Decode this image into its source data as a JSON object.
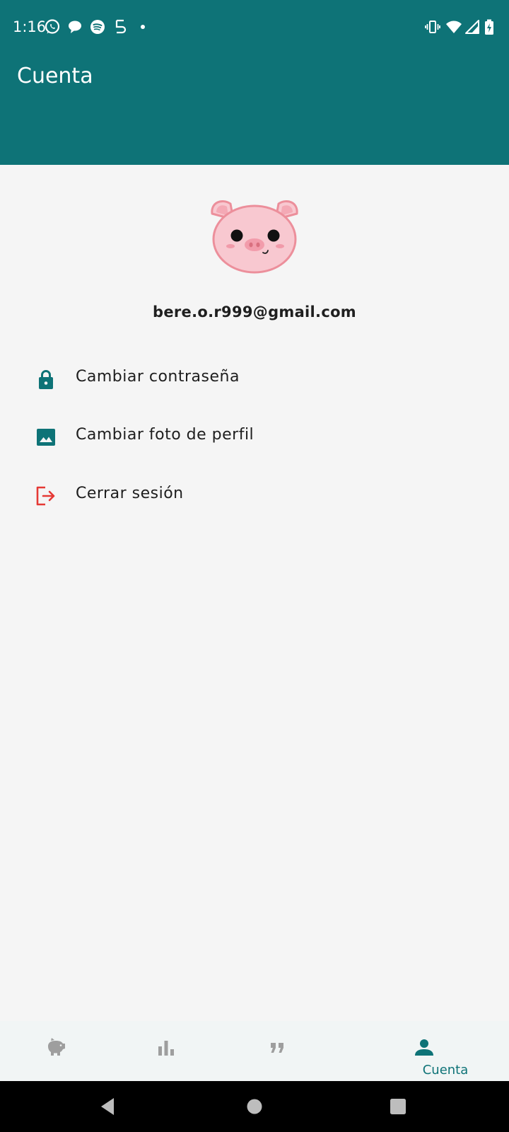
{
  "status_bar": {
    "time": "1:16",
    "notification_icons": [
      "whatsapp-icon",
      "chat-bubble-icon",
      "spotify-icon",
      "s-app-icon",
      "dot-icon"
    ],
    "system_icons": [
      "vibrate-icon",
      "wifi-icon",
      "signal-icon",
      "battery-charging-icon"
    ]
  },
  "app_bar": {
    "title": "Cuenta"
  },
  "profile": {
    "avatar_icon": "pig-face-icon",
    "email": "bere.o.r999@gmail.com"
  },
  "menu": {
    "items": [
      {
        "label": "Cambiar contraseña",
        "icon": "lock-icon"
      },
      {
        "label": "Cambiar foto de perfil",
        "icon": "image-icon"
      },
      {
        "label": "Cerrar sesión",
        "icon": "logout-icon"
      }
    ]
  },
  "bottom_nav": {
    "items": [
      {
        "icon": "piggy-bank-icon",
        "label": ""
      },
      {
        "icon": "bar-chart-icon",
        "label": ""
      },
      {
        "icon": "quote-icon",
        "label": ""
      },
      {
        "icon": "person-icon",
        "label": "Cuenta",
        "selected": true
      }
    ]
  },
  "colors": {
    "primary": "#0e7377",
    "background": "#f5f5f5",
    "logout_red": "#e53935",
    "inactive_icon": "#9e9e9e"
  },
  "system_nav": {
    "buttons": [
      "back-icon",
      "home-icon",
      "recents-icon"
    ]
  }
}
